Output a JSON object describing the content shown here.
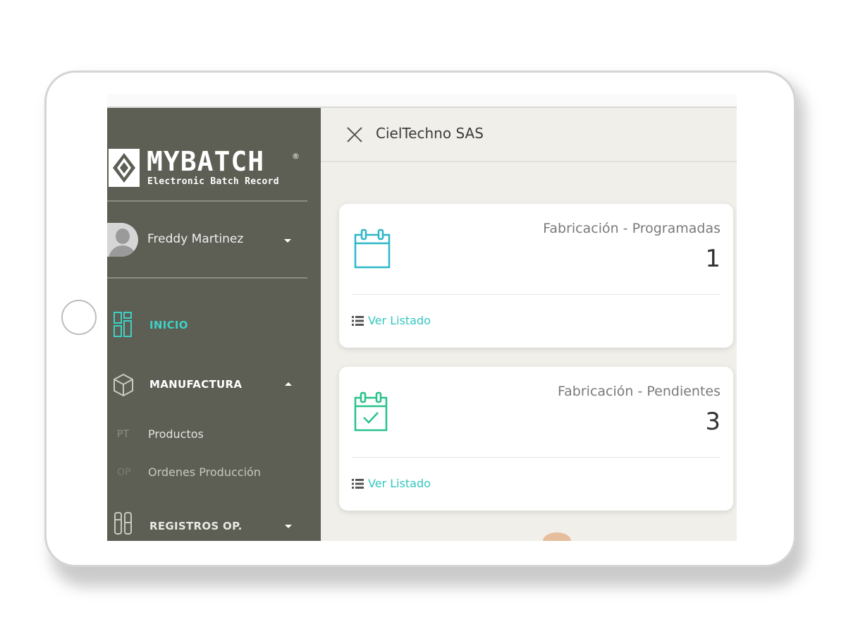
{
  "brand": {
    "name": "MYBATCH",
    "registered": "®",
    "tagline": "Electronic Batch Record"
  },
  "user": {
    "name": "Freddy Martinez"
  },
  "nav": {
    "inicio": "INICIO",
    "manufactura": "MANUFACTURA",
    "submenu": [
      {
        "abbr": "PT",
        "label": "Productos"
      },
      {
        "abbr": "OP",
        "label": "Ordenes Producción"
      }
    ],
    "registros": "REGISTROS OP."
  },
  "header": {
    "company": "CielTechno SAS"
  },
  "cards": [
    {
      "title": "Fabricación - Programadas",
      "value": "1",
      "link": "Ver Listado",
      "icon": "calendar-icon",
      "color": "#2bb7c8"
    },
    {
      "title": "Fabricación - Pendientes",
      "value": "3",
      "link": "Ver Listado",
      "icon": "calendar-check-icon",
      "color": "#27c28a"
    }
  ],
  "colors": {
    "sidebar": "#5d5e54",
    "accent": "#34c6bf",
    "active_nav": "#3fd0c4"
  }
}
